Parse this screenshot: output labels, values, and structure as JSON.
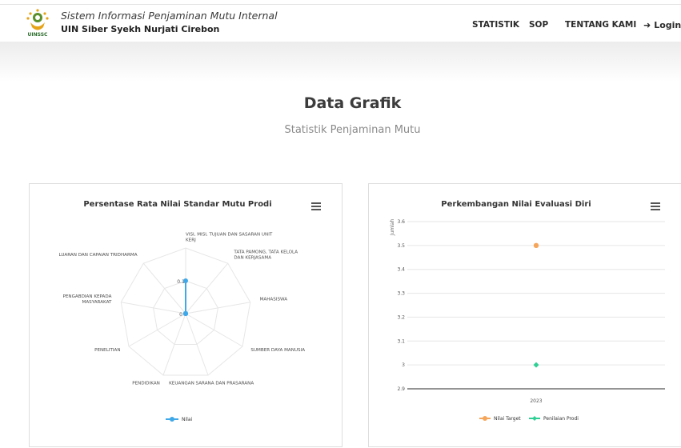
{
  "header": {
    "brand_line1": "Sistem Informasi Penjaminan Mutu Internal",
    "brand_line2": "UIN Siber Syekh Nurjati Cirebon",
    "logo_text": "UINSSC",
    "nav": [
      {
        "label": "STATISTIK"
      },
      {
        "label": "SOP"
      },
      {
        "label": "TENTANG KAMI"
      },
      {
        "label": "Login",
        "icon": "login-icon"
      }
    ]
  },
  "page": {
    "title": "Data Grafik",
    "subtitle": "Statistik Penjaminan Mutu"
  },
  "colors": {
    "nilai": "#3fa8e8",
    "nilai_target": "#f5a65b",
    "penilaian_prodi": "#2fcf95",
    "grid": "#e6e6e6"
  },
  "chart_data": [
    {
      "type": "radar",
      "title": "Persentase Rata Nilai Standar Mutu Prodi",
      "categories": [
        "VISI, MISI, TUJUAN DAN SASARAN UNIT KERJ",
        "TATA PAMONG, TATA KELOLA DAN KERJASAMA",
        "MAHASISWA",
        "SUMBER DAYA MANUSIA",
        "KEUANGAN SARANA DAN PRASARANA",
        "PENDIDIKAN",
        "PENELITIAN",
        "PENGABDIAN KEPADA MASYARAKAT",
        "LUARAN DAN CAPAIAN TRIDHARMA"
      ],
      "category_lines": [
        [
          "VISI, MISI, TUJUAN DAN SASARAN UNIT",
          "KERJ"
        ],
        [
          "TATA PAMONG, TATA KELOLA",
          "DAN KERJASAMA"
        ],
        [
          "MAHASISWA"
        ],
        [
          "SUMBER DAYA MANUSIA"
        ],
        [
          "KEUANGAN SARANA DAN PRASARANA"
        ],
        [
          "PENDIDIKAN"
        ],
        [
          "PENELITIAN"
        ],
        [
          "PENGABDIAN KEPADA",
          "MASYARAKAT"
        ],
        [
          "LUARAN DAN CAPAIAN TRIDHARMA"
        ]
      ],
      "radial_ticks": [
        "0",
        "0.1"
      ],
      "rmax": 0.2,
      "series": [
        {
          "name": "Nilai",
          "values": [
            0.1,
            0,
            0,
            0,
            0,
            0,
            0,
            0,
            0
          ]
        }
      ],
      "legend": "bottom"
    },
    {
      "type": "scatter",
      "title": "Perkembangan Nilai Evaluasi Diri",
      "ylabel": "Jumlah",
      "categories": [
        "2023"
      ],
      "ylim": [
        2.9,
        3.6
      ],
      "yticks": [
        "2.9",
        "3",
        "3.1",
        "3.2",
        "3.3",
        "3.4",
        "3.5",
        "3.6"
      ],
      "series": [
        {
          "name": "Nilai Target",
          "values": [
            3.5
          ]
        },
        {
          "name": "Penilaian Prodi",
          "values": [
            3
          ]
        }
      ],
      "legend": "bottom"
    }
  ]
}
